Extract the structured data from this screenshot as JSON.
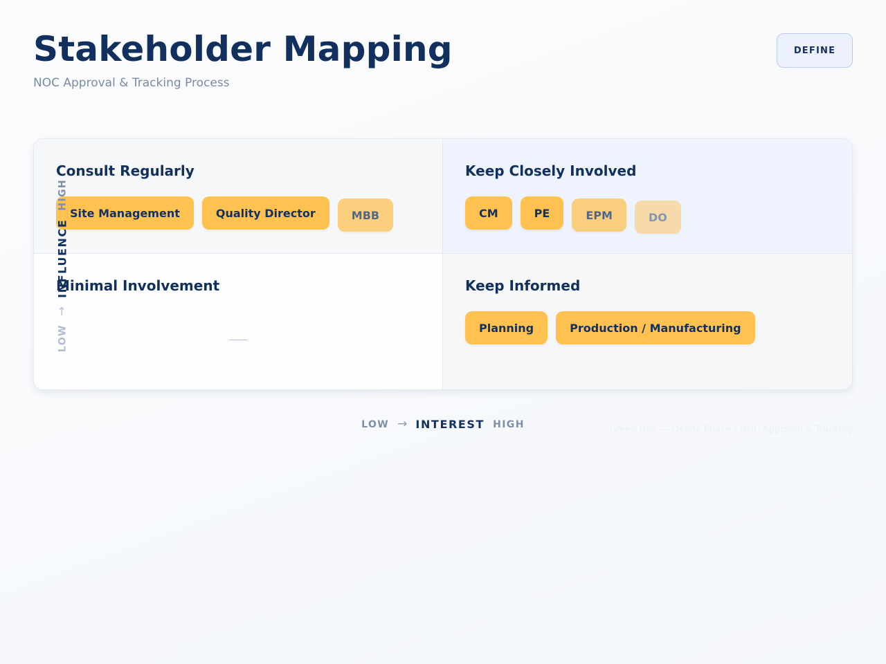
{
  "header": {
    "title": "Stakeholder Mapping",
    "subtitle": "NOC Approval & Tracking Process",
    "phase_badge": "DEFINE"
  },
  "matrix": {
    "quadrants": {
      "consult_regularly": {
        "title": "Consult Regularly",
        "stakeholders": [
          "Site Management",
          "Quality Director",
          "MBB"
        ]
      },
      "keep_closely_involved": {
        "title": "Keep Closely Involved",
        "stakeholders": [
          "CM",
          "PE",
          "EPM",
          "DO"
        ]
      },
      "minimal_involvement": {
        "title": "Minimal Involvement",
        "empty_marker": "—"
      },
      "keep_informed": {
        "title": "Keep Informed",
        "stakeholders": [
          "Planning",
          "Production / Manufacturing"
        ]
      }
    },
    "y_axis": {
      "name": "INFLUENCE",
      "low": "LOW",
      "high": "HIGH",
      "arrow_icon": "arrow-up-icon"
    },
    "x_axis": {
      "name": "INTEREST",
      "low": "LOW",
      "high": "HIGH",
      "arrow_icon": "arrow-right-icon"
    }
  },
  "footer": {
    "note": "Green Belt — Define Phase | NOC Approval & Tracking"
  },
  "colors": {
    "navy": "#12305e",
    "chip_amber": "#ffc14f",
    "muted_text": "#7a8aa6",
    "badge_bg": "#edf1fb",
    "involved_bg": "#eef3fd"
  }
}
